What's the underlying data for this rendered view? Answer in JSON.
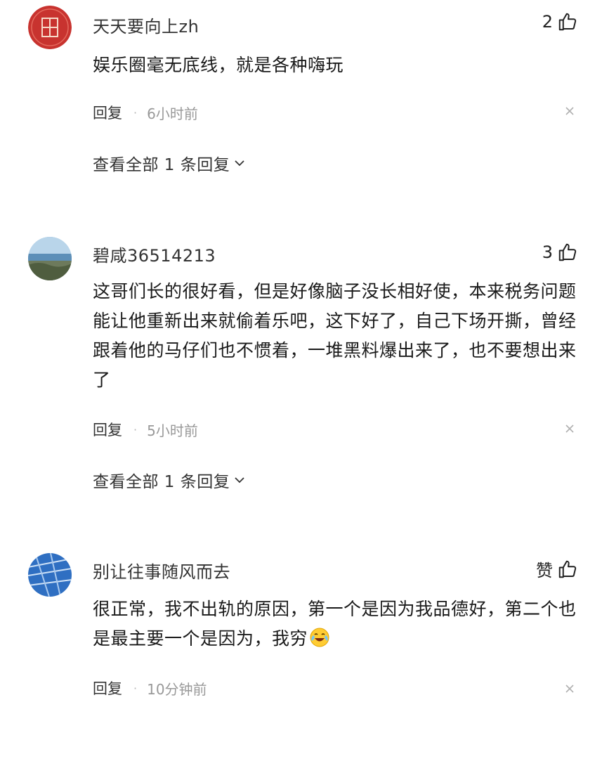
{
  "comments": [
    {
      "username": "天天要向上zh",
      "like_label": "2",
      "content": "娱乐圈毫无底线，就是各种嗨玩",
      "reply_label": "回复",
      "separator": "·",
      "time": "6小时前",
      "view_replies": "查看全部 1 条回复",
      "avatar_icon": "fu-character-avatar-icon",
      "avatar_color": "#c8332f"
    },
    {
      "username": "碧咸36514213",
      "like_label": "3",
      "content": "这哥们长的很好看，但是好像脑子没长相好使，本来税务问题能让他重新出来就偷着乐吧，这下好了，自己下场开撕，曾经跟着他的马仔们也不惯着，一堆黑料爆出来了，也不要想出来了",
      "reply_label": "回复",
      "separator": "·",
      "time": "5小时前",
      "view_replies": "查看全部 1 条回复",
      "avatar_icon": "landscape-avatar-icon",
      "avatar_color": "#6a9fc7"
    },
    {
      "username": "别让往事随风而去",
      "like_label": "赞",
      "content": "很正常，我不出轨的原因，第一个是因为我品德好，第二个也是最主要一个是因为，我穷",
      "emoji_icon": "laugh-cry-emoji-icon",
      "reply_label": "回复",
      "separator": "·",
      "time": "10分钟前",
      "avatar_icon": "blue-lines-avatar-icon",
      "avatar_color": "#2f6fc2"
    }
  ],
  "icons": {
    "like": "thumbs-up-icon",
    "close": "close-icon",
    "expand": "chevron-down-icon"
  }
}
